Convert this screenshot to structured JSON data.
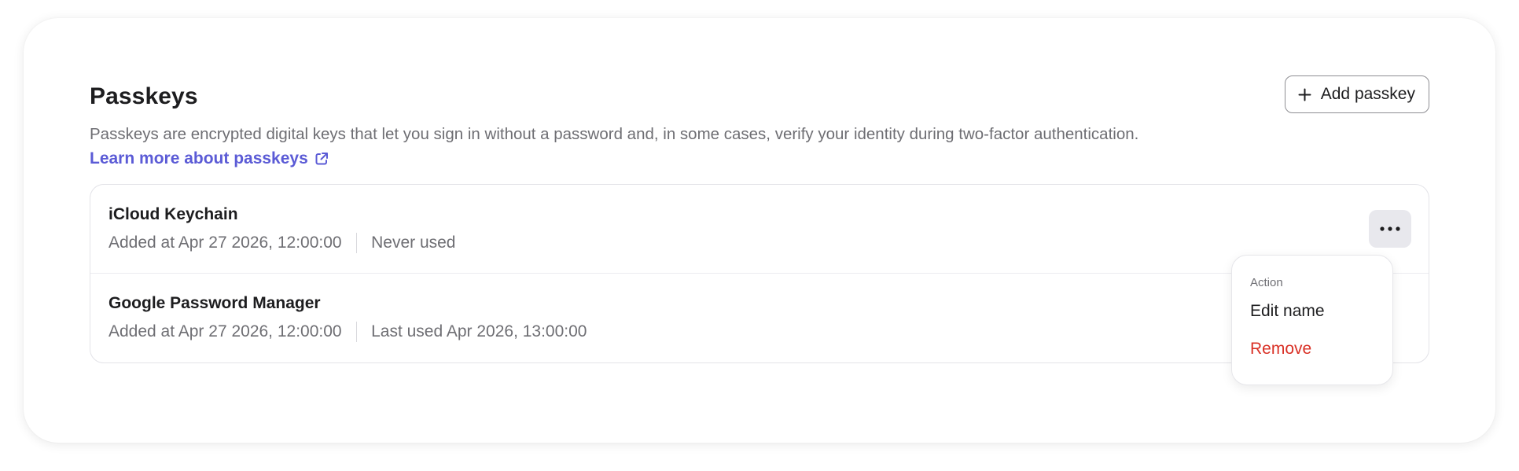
{
  "section": {
    "title": "Passkeys",
    "add_button_label": "Add passkey",
    "description": "Passkeys are encrypted digital keys that let you sign in without a password and, in some cases, verify your identity during two-factor authentication.",
    "learn_more_label": "Learn more about passkeys"
  },
  "passkeys": [
    {
      "name": "iCloud Keychain",
      "added": "Added at Apr 27 2026, 12:00:00",
      "usage": "Never used"
    },
    {
      "name": "Google Password Manager",
      "added": "Added at Apr 27 2026, 12:00:00",
      "usage": "Last used Apr 2026, 13:00:00"
    }
  ],
  "action_menu": {
    "heading": "Action",
    "items": [
      "Edit name",
      "Remove"
    ]
  },
  "icons": {
    "add": "plus-icon",
    "learn_more": "external-link-icon",
    "more": "more-horizontal-icon"
  },
  "colors": {
    "link": "#5b5bd6",
    "danger": "#d93025",
    "text_primary": "#1d1d1f",
    "text_secondary": "#6e6e73"
  }
}
